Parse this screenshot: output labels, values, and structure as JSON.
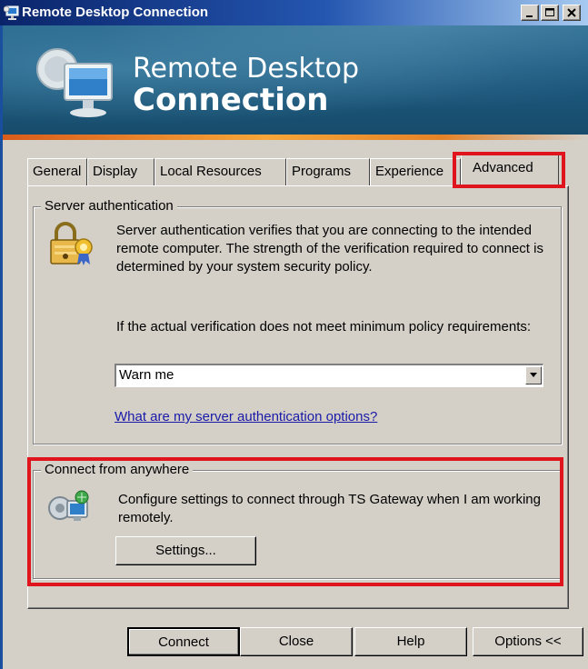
{
  "window": {
    "title": "Remote Desktop Connection",
    "controls": [
      "minimize",
      "maximize",
      "close"
    ]
  },
  "banner": {
    "line1": "Remote Desktop",
    "line2": "Connection"
  },
  "tabs": [
    {
      "label": "General",
      "active": false
    },
    {
      "label": "Display",
      "active": false
    },
    {
      "label": "Local Resources",
      "active": false
    },
    {
      "label": "Programs",
      "active": false
    },
    {
      "label": "Experience",
      "active": false
    },
    {
      "label": "Advanced",
      "active": true
    }
  ],
  "server_auth": {
    "group_label": "Server authentication",
    "description": "Server authentication verifies that you are connecting to the intended remote computer. The strength of the verification required to connect is determined by your system security policy.",
    "policy_prompt": "If the actual verification does not meet minimum policy requirements:",
    "dropdown_value": "Warn me",
    "help_link": "What are my server authentication options?",
    "icon": "lock-certificate-icon"
  },
  "connect_anywhere": {
    "group_label": "Connect from anywhere",
    "description": "Configure settings to connect through TS Gateway when I am working remotely.",
    "settings_button": "Settings...",
    "icon": "ts-gateway-icon"
  },
  "footer": {
    "connect": "Connect",
    "close": "Close",
    "help": "Help",
    "options": "Options <<"
  },
  "highlight_color": "#e0141c"
}
